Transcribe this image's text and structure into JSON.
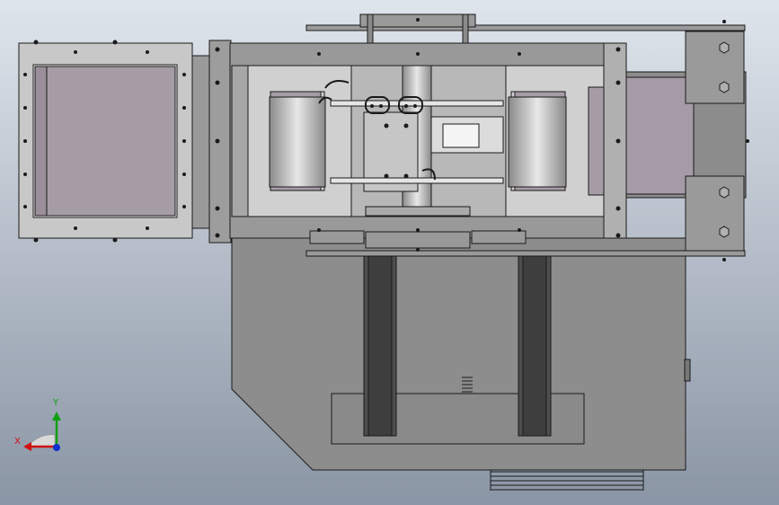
{
  "viewport": {
    "background_top": "#dfe5ec",
    "background_bottom": "#8a95a5",
    "model_fill": "#8f8f8f",
    "model_stroke": "#1a1a1a",
    "window_fill": "#a69ca6",
    "slot_fill": "#4a4a4a"
  },
  "triad": {
    "x_label": "X",
    "y_label": "Y",
    "x_color": "#d01010",
    "y_color": "#10a010",
    "z_color": "#1030d0"
  }
}
